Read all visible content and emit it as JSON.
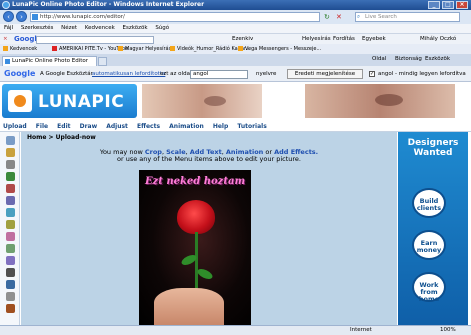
{
  "window": {
    "title": "LunaPic Online Photo Editor - Windows Internet Explorer"
  },
  "browser": {
    "address": "http://www.lunapic.com/editor/",
    "search_placeholder": "Live Search",
    "menu": [
      "Fájl",
      "Szerkesztés",
      "Nézet",
      "Kedvencek",
      "Eszközök",
      "Súgó"
    ],
    "google_toolbar": {
      "logo": "Google",
      "items": [
        "Ezenkiv",
        "Helyesírás",
        "Fordítás",
        "Egyebek",
        "Mihály Oczkó"
      ]
    },
    "favorites": {
      "label": "Kedvencek",
      "items": [
        "AMERIKAI PITE.Tv - YouTube",
        "Magyar Helyesírás",
        "Videók_Humor_Rádió Kabar...",
        "Vega Messengers - Messzeje..."
      ]
    },
    "tab_title": "LunaPic Online Photo Editor",
    "right_tools": [
      "Oldal",
      "Biztonság",
      "Eszközök"
    ]
  },
  "translate_bar": {
    "logo": "Google",
    "prefix": "A Google Eszköztár",
    "link": "automatikusan lefordította",
    "middle": "ezt az oldalt:",
    "language": "angol",
    "suffix": "nyelvre",
    "original_button": "Eredeti megjelenítése",
    "checkbox_label": "angol - mindig legyen lefordítva"
  },
  "app": {
    "logo_text": "LUNAPIC",
    "menu": [
      "Upload",
      "File",
      "Edit",
      "Draw",
      "Adjust",
      "Effects",
      "Animation",
      "Help",
      "Tutorials"
    ],
    "breadcrumb": "Home > Upload-now",
    "message_line1_pre": "You may now",
    "message_links": [
      "Crop",
      "Scale",
      "Add Text",
      "Animation",
      "Add Effects."
    ],
    "message_or": "or",
    "message_line2": "or use any of the Menu items above to edit your picture.",
    "photo_caption": "Ezt neked hoztam",
    "ad": {
      "headline": "Designers Wanted",
      "bubbles": [
        "Build clients",
        "Earn money",
        "Work from home"
      ]
    }
  },
  "status": {
    "zone": "Internet",
    "zoom": "100%"
  },
  "colors": {
    "accent": "#1f4fb0",
    "content_bg": "#bcd3e6",
    "ad_bg": "#1a7cc7"
  }
}
